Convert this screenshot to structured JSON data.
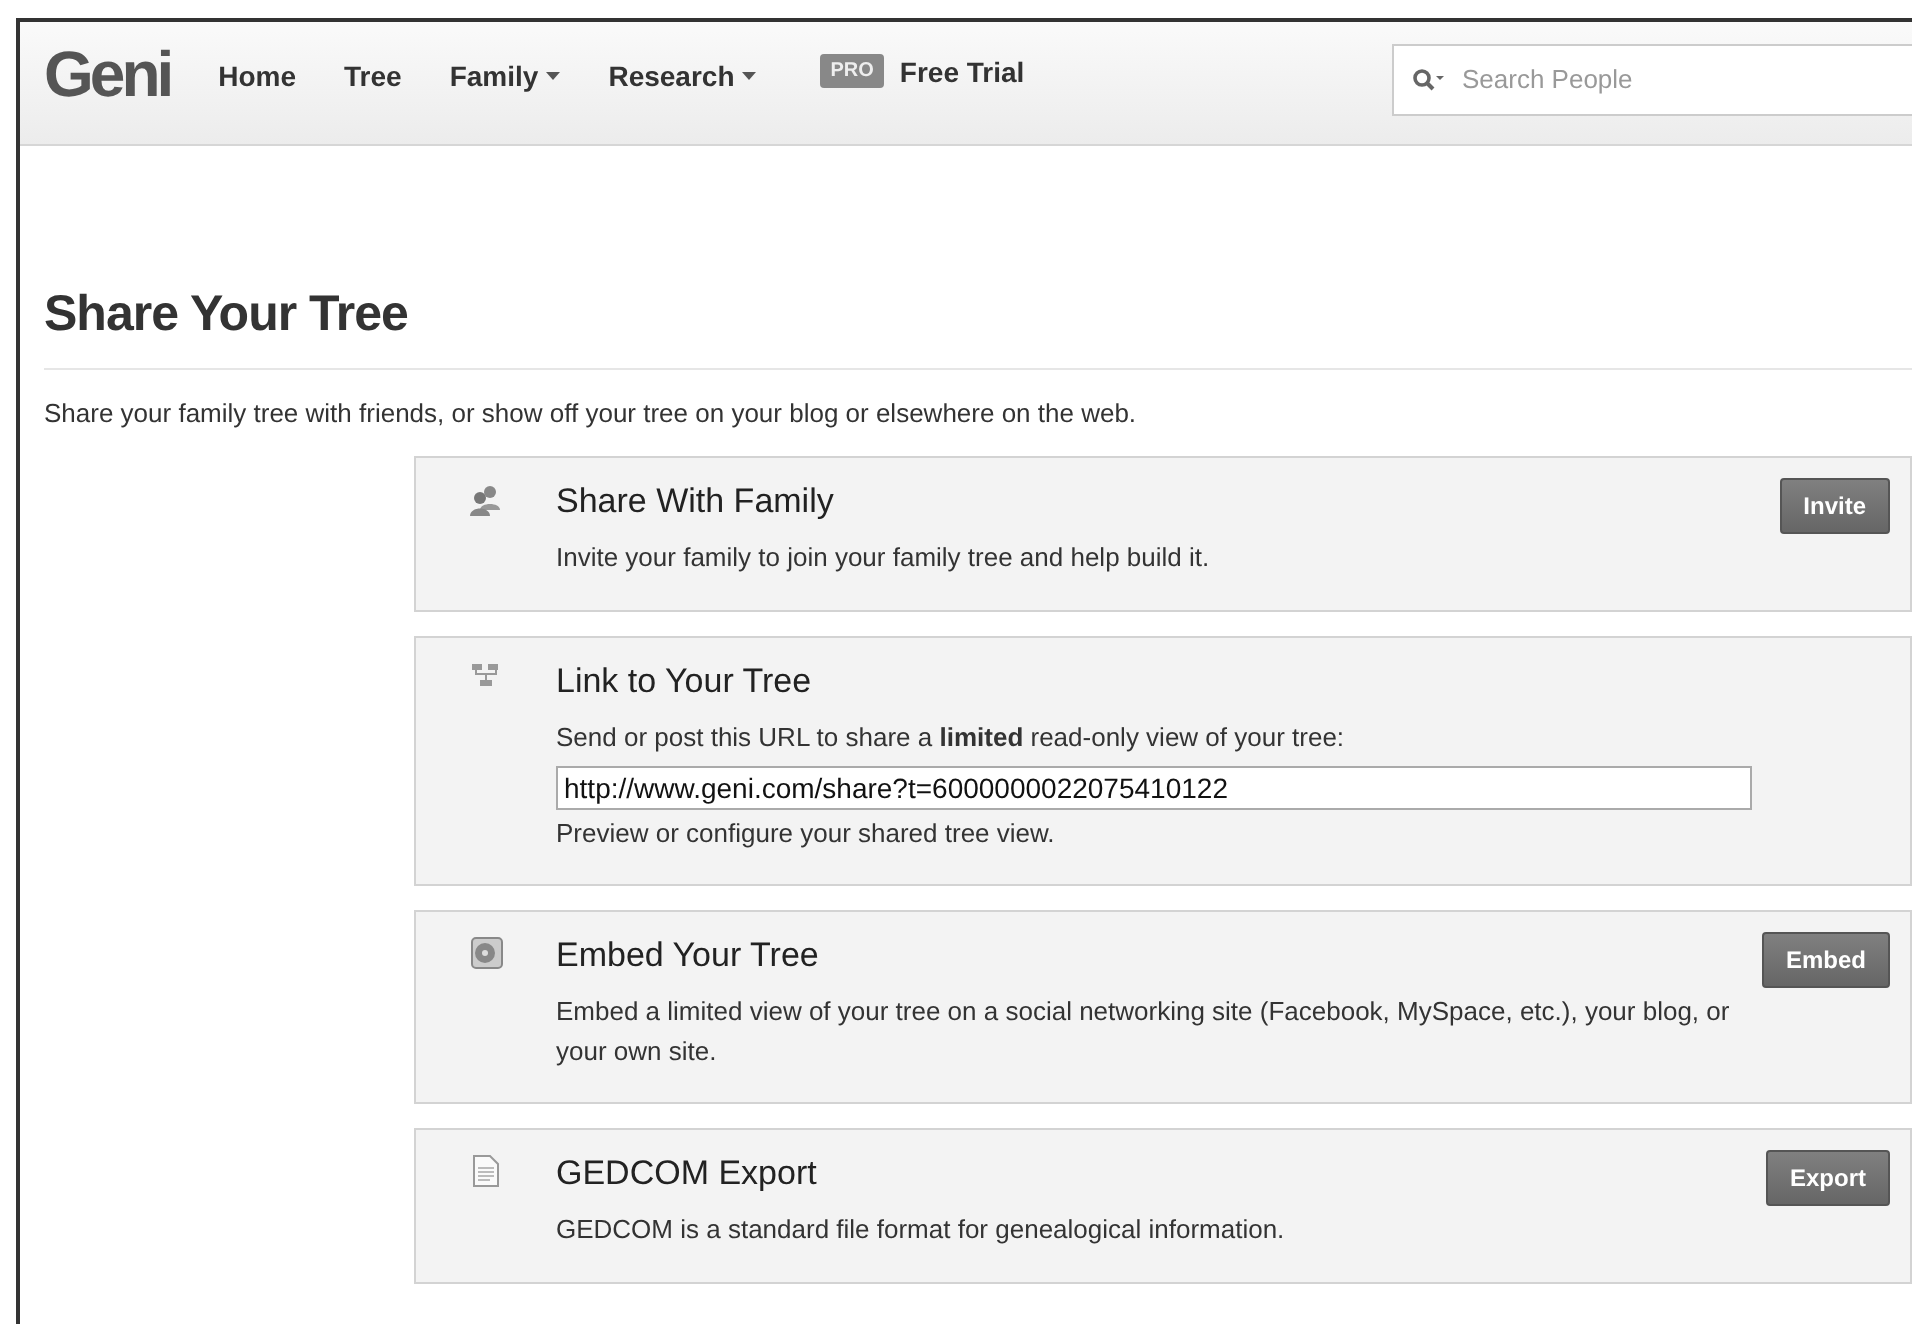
{
  "header": {
    "logo": "Geni",
    "nav": [
      {
        "label": "Home",
        "menu": false
      },
      {
        "label": "Tree",
        "menu": false
      },
      {
        "label": "Family",
        "menu": true
      },
      {
        "label": "Research",
        "menu": true
      }
    ],
    "trial": {
      "badge": "PRO",
      "label": "Free Trial"
    },
    "search": {
      "placeholder": "Search People"
    }
  },
  "page": {
    "title": "Share Your Tree",
    "intro": "Share your family tree with friends, or show off your tree on your blog or elsewhere on the web."
  },
  "cards": [
    {
      "kind": "people",
      "title": "Share With Family",
      "lines": [
        "Invite your family to join your family tree and help build it."
      ],
      "button": "Invite"
    },
    {
      "kind": "tree",
      "title": "Link to Your Tree",
      "lines": [
        "Send or post this URL to share a **limited** read-only view of your tree:"
      ],
      "url": "http://www.geni.com/share?t=6000000022075410122",
      "note": "Preview or configure your shared tree view."
    },
    {
      "kind": "embed",
      "title": "Embed Your Tree",
      "lines": [
        "Embed a limited view of your tree on a social networking site (Facebook, MySpace, etc.), your blog, or your own site."
      ],
      "button": "Embed"
    },
    {
      "kind": "document",
      "title": "GEDCOM Export",
      "lines": [
        "GEDCOM is a standard file format for genealogical information."
      ],
      "button": "Export"
    }
  ]
}
